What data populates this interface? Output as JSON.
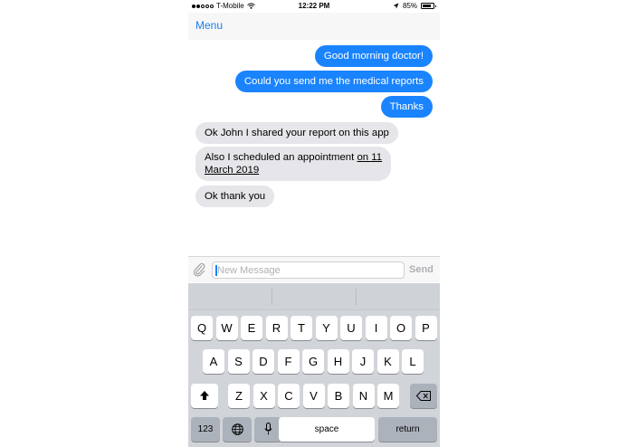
{
  "status_bar": {
    "carrier": "T-Mobile",
    "time": "12:22 PM",
    "battery": "85%",
    "battery_level": 0.85
  },
  "nav": {
    "menu_label": "Menu"
  },
  "messages": [
    {
      "direction": "out",
      "text": "Good morning doctor!"
    },
    {
      "direction": "out",
      "text": "Could you send me the medical reports"
    },
    {
      "direction": "out",
      "text": "Thanks"
    },
    {
      "direction": "in",
      "text": "Ok John I shared your report on this app"
    },
    {
      "direction": "in",
      "text_line1_prefix": "Also I scheduled an appointment ",
      "text_line1_link": "on 11",
      "text_line2_link": "March 2019"
    },
    {
      "direction": "in",
      "text": "Ok thank you"
    }
  ],
  "composer": {
    "placeholder": "New Message",
    "send_label": "Send",
    "attach_icon": "paperclip-icon"
  },
  "keyboard": {
    "row1": [
      "Q",
      "W",
      "E",
      "R",
      "T",
      "Y",
      "U",
      "I",
      "O",
      "P"
    ],
    "row2": [
      "A",
      "S",
      "D",
      "F",
      "G",
      "H",
      "J",
      "K",
      "L"
    ],
    "row3": [
      "Z",
      "X",
      "C",
      "V",
      "B",
      "N",
      "M"
    ],
    "numbers_label": "123",
    "space_label": "space",
    "return_label": "return",
    "shift_icon": "shift-icon",
    "delete_icon": "backspace-icon",
    "globe_icon": "globe-icon",
    "mic_icon": "microphone-icon"
  },
  "colors": {
    "accent": "#1a7ff0",
    "outgoing_bubble": "#1a84ff",
    "incoming_bubble": "#e5e5ea"
  }
}
